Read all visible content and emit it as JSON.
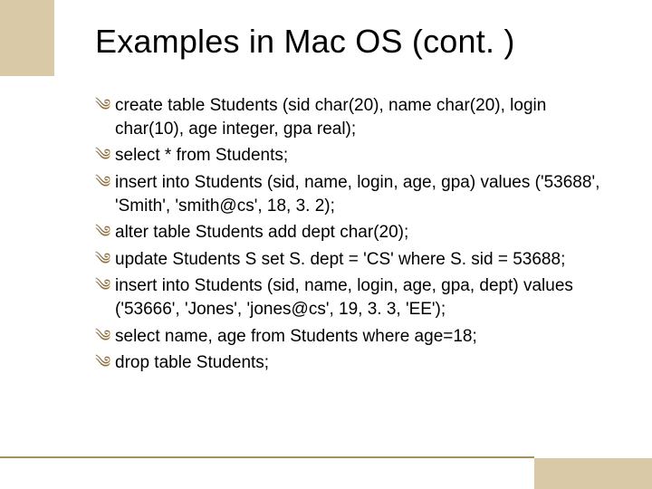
{
  "title": "Examples in Mac OS (cont. )",
  "bullet_glyph": "༄",
  "items": [
    "create table Students (sid char(20), name char(20), login char(10), age integer, gpa real);",
    "select * from Students;",
    "insert into Students (sid, name, login, age, gpa) values ('53688', 'Smith', 'smith@cs', 18, 3. 2);",
    "alter table Students add dept char(20);",
    "update Students S set S. dept = 'CS' where S. sid = 53688;",
    "insert into Students (sid, name, login, age, gpa, dept) values ('53666', 'Jones', 'jones@cs', 19, 3. 3, 'EE');",
    "select name, age from Students where age=18;",
    "drop table Students;"
  ]
}
